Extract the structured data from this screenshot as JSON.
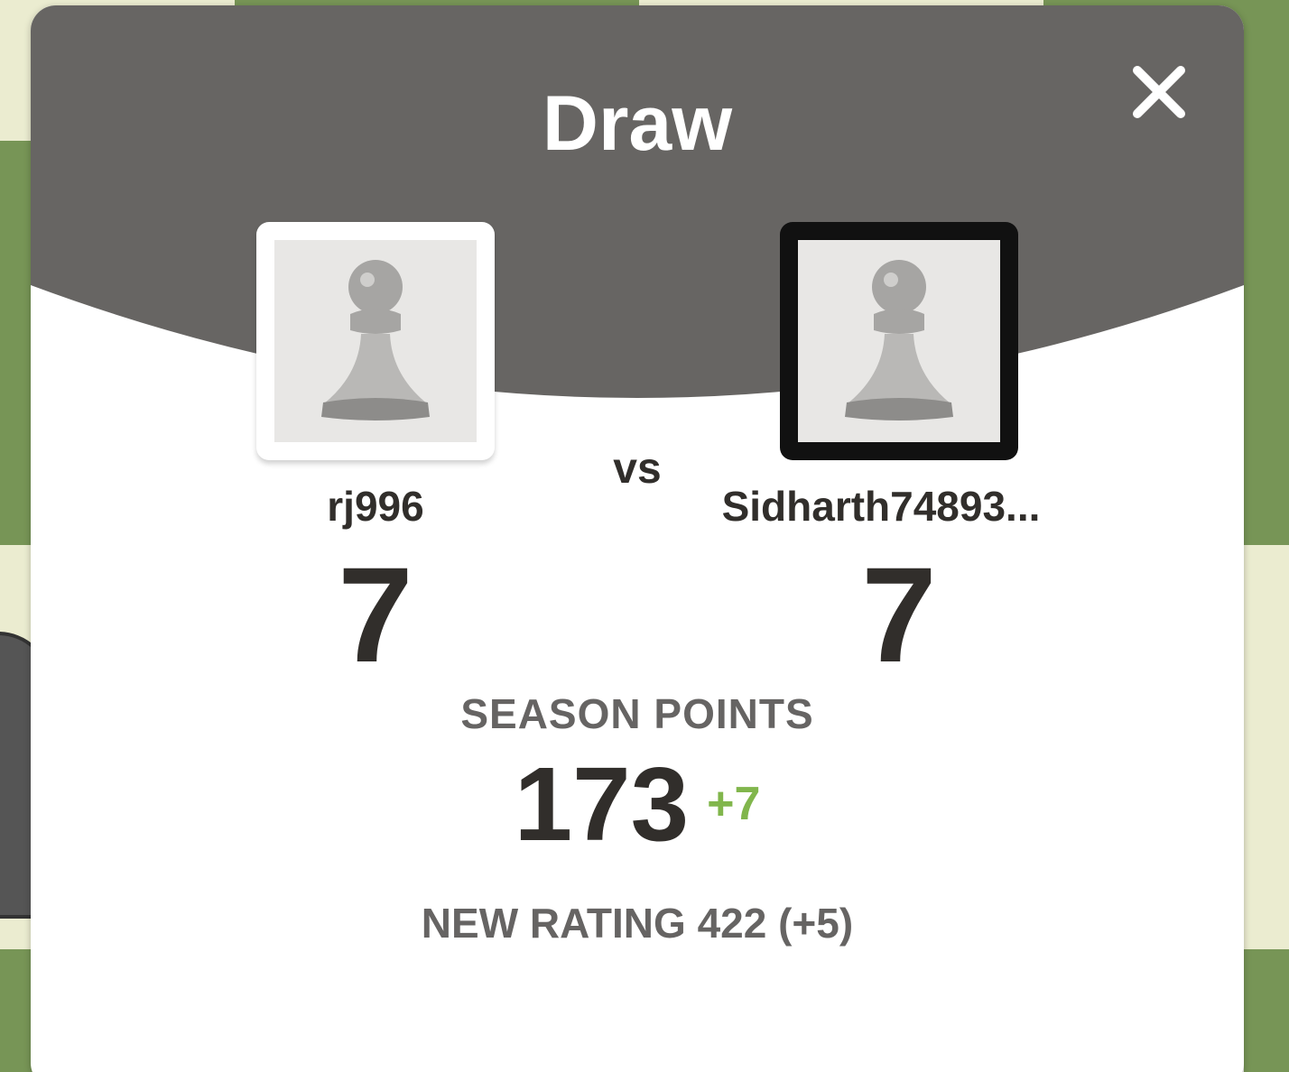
{
  "modal": {
    "title": "Draw",
    "vs_label": "vs",
    "header_color": "#676563"
  },
  "players": {
    "white": {
      "name": "rj996",
      "score": "7",
      "avatar_icon": "pawn-icon"
    },
    "black": {
      "name": "Sidharth74893...",
      "score": "7",
      "avatar_icon": "pawn-icon"
    }
  },
  "season": {
    "label": "SEASON POINTS",
    "value": "173",
    "delta": "+7"
  },
  "rating": {
    "text": "NEW RATING 422 (+5)"
  },
  "colors": {
    "board_light": "#ebecd0",
    "board_dark": "#779556",
    "positive": "#81b64c",
    "text_dark": "#312e2b",
    "text_muted": "#666463"
  }
}
